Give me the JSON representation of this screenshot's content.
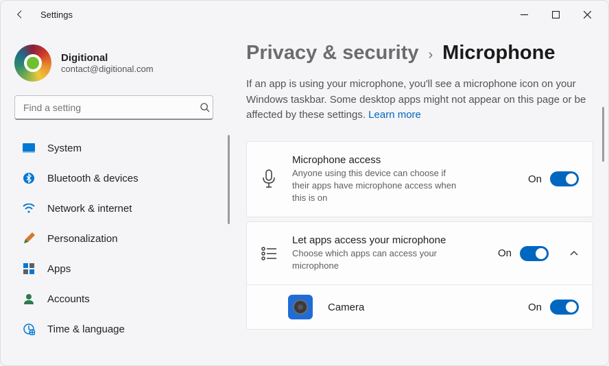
{
  "window": {
    "title": "Settings"
  },
  "user": {
    "name": "Digitional",
    "email": "contact@digitional.com"
  },
  "search": {
    "placeholder": "Find a setting"
  },
  "sidebar": {
    "items": [
      {
        "label": "System"
      },
      {
        "label": "Bluetooth & devices"
      },
      {
        "label": "Network & internet"
      },
      {
        "label": "Personalization"
      },
      {
        "label": "Apps"
      },
      {
        "label": "Accounts"
      },
      {
        "label": "Time & language"
      }
    ]
  },
  "breadcrumb": {
    "parent": "Privacy & security",
    "current": "Microphone"
  },
  "intro": {
    "text": "If an app is using your microphone, you'll see a microphone icon on your Windows taskbar. Some desktop apps might not appear on this page or be affected by these settings.  ",
    "learn_more": "Learn more"
  },
  "cards": {
    "mic_access": {
      "title": "Microphone access",
      "sub": "Anyone using this device can choose if their apps have microphone access when this is on",
      "state": "On"
    },
    "apps_access": {
      "title": "Let apps access your microphone",
      "sub": "Choose which apps can access your microphone",
      "state": "On"
    },
    "camera_app": {
      "name": "Camera",
      "state": "On"
    }
  }
}
